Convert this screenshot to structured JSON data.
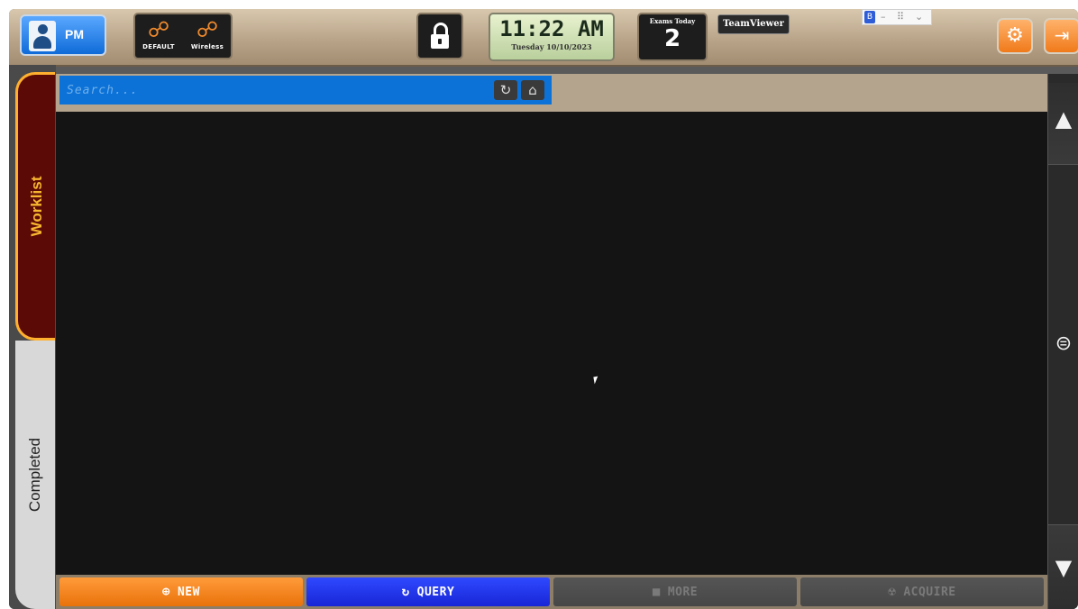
{
  "user": {
    "label": "PM"
  },
  "network": {
    "items": [
      {
        "label": "DEFAULT"
      },
      {
        "label": "Wireless"
      }
    ]
  },
  "clock": {
    "time": "11:22 AM",
    "date": "Tuesday 10/10/2023"
  },
  "exams_today": {
    "label": "Exams Today",
    "count": "2"
  },
  "teamviewer": {
    "label": "TeamViewer"
  },
  "mini_toolbar": {
    "app_icon": "B",
    "minimize": "–",
    "grip": "⠿",
    "chevron": "⌄"
  },
  "tabs": {
    "worklist": "Worklist",
    "completed": "Completed"
  },
  "search": {
    "placeholder": "Search..."
  },
  "actions": {
    "new": "NEW",
    "query": "QUERY",
    "more": "MORE",
    "acquire": "ACQUIRE"
  },
  "colors": {
    "accent_orange": "#f07a1a",
    "query_blue": "#1826d6",
    "search_blue": "#0c72d8",
    "worklist_tab": "#5c0a05"
  }
}
